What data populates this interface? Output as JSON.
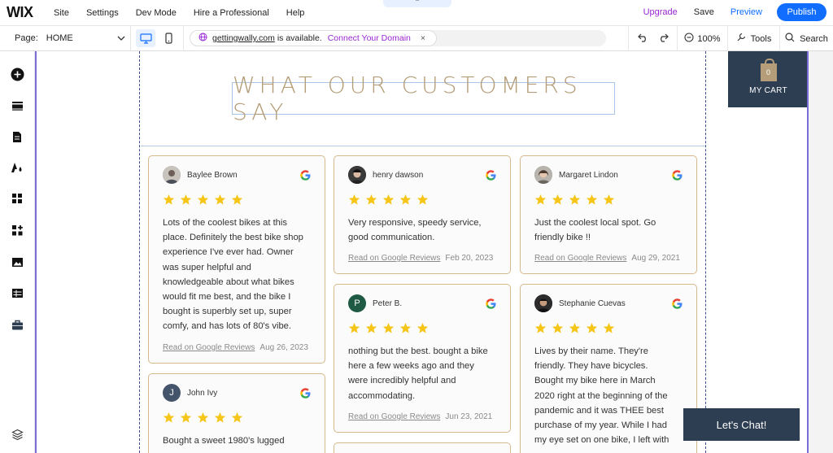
{
  "topbar": {
    "logo": "WIX",
    "nav": [
      "Site",
      "Settings",
      "Dev Mode",
      "Hire a Professional",
      "Help"
    ],
    "upgrade": "Upgrade",
    "save": "Save",
    "preview": "Preview",
    "publish": "Publish"
  },
  "toolbar": {
    "page_label": "Page:",
    "page_value": "HOME",
    "domain": "gettingwally.com",
    "domain_status": "is available.",
    "connect": "Connect Your Domain",
    "zoom": "100%",
    "tools": "Tools",
    "search": "Search"
  },
  "sidebar": {
    "icons": [
      "add-icon",
      "sections-icon",
      "pages-icon",
      "design-icon",
      "apps-icon",
      "app-market-icon",
      "media-icon",
      "cms-icon",
      "business-icon",
      "layers-icon"
    ]
  },
  "colors": {
    "accent": "#116dff",
    "upgrade": "#9a27d5",
    "heading": "#b49d78",
    "card_border": "#d6b98c",
    "dark_panel": "#2d3e52",
    "star": "#f5c518"
  },
  "page": {
    "heading": "WHAT OUR CUSTOMERS SAY",
    "cart_count": "0",
    "cart_label": "MY CART",
    "chat_label": "Let's Chat!",
    "link_text": "Read on Google Reviews",
    "rating_stars": 5,
    "reviews": [
      {
        "name": "Baylee Brown",
        "text_lines": [
          "Lots of the coolest bikes at this",
          "place. Definitely the best bike shop",
          "experience I've ever had. Owner",
          "was super helpful and",
          "knowledgeable about what bikes",
          "would fit me best, and the bike I",
          "bought is superbly set up, super",
          "comfy, and has lots of 80's vibe."
        ],
        "date": "Aug 26, 2023"
      },
      {
        "name": "henry dawson",
        "text_lines": [
          "Very responsive, speedy service,",
          "good communication."
        ],
        "date": "Feb 20, 2023"
      },
      {
        "name": "Margaret Lindon",
        "text_lines": [
          "Just the coolest local spot. Go",
          "friendly bike !!"
        ],
        "date": "Aug 29, 2021"
      },
      {
        "name": "Peter B.",
        "initial": "P",
        "text_lines": [
          "nothing but the best. bought a bike",
          "here a few weeks ago and they",
          "were incredibly helpful and",
          "accommodating."
        ],
        "date": "Jun 23, 2021"
      },
      {
        "name": "Stephanie Cuevas",
        "text_lines": [
          "Lives by their name. They're",
          "friendly. They have bicycles.",
          "Bought my bike here in March",
          "2020 right at the beginning of the",
          "pandemic and it was THEE best",
          "purchase of my year. While I had",
          "my eye set on one bike, I left with"
        ],
        "date": ""
      },
      {
        "name": "John Ivy",
        "initial": "J",
        "text_lines": [
          "Bought a sweet 1980's lugged"
        ],
        "date": ""
      }
    ]
  }
}
